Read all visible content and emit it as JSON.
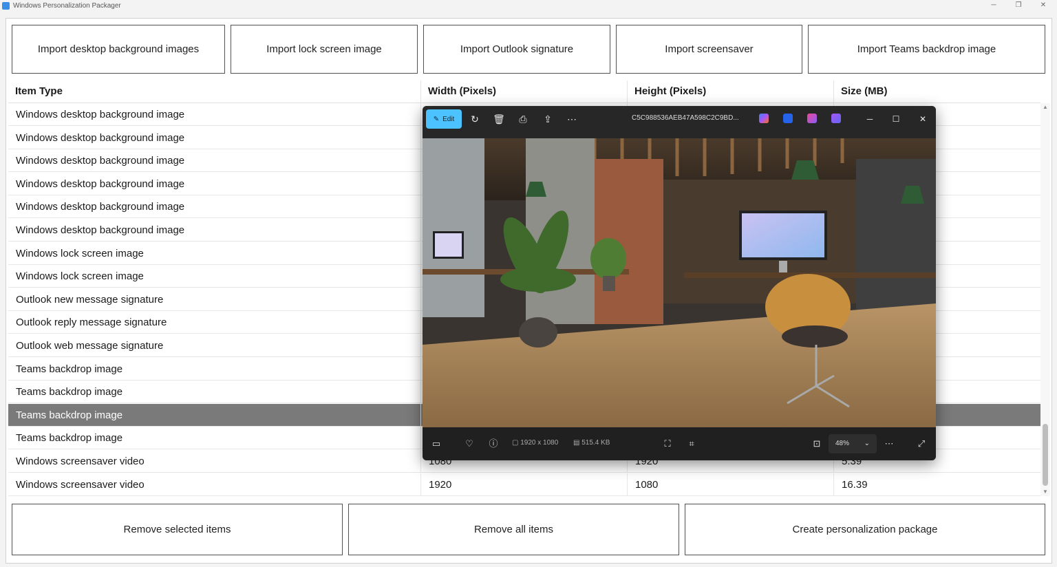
{
  "window": {
    "title": "Windows Personalization Packager",
    "controls": {
      "minimize": "─",
      "restore": "❐",
      "close": "✕"
    }
  },
  "import_buttons": [
    "Import desktop background images",
    "Import lock screen image",
    "Import Outlook signature",
    "Import screensaver",
    "Import Teams backdrop image"
  ],
  "table": {
    "columns": [
      "Item Type",
      "Width (Pixels)",
      "Height (Pixels)",
      "Size (MB)"
    ],
    "rows": [
      [
        "Windows desktop background image",
        "",
        "",
        ""
      ],
      [
        "Windows desktop background image",
        "",
        "",
        ""
      ],
      [
        "Windows desktop background image",
        "",
        "",
        ""
      ],
      [
        "Windows desktop background image",
        "",
        "",
        ""
      ],
      [
        "Windows desktop background image",
        "",
        "",
        ""
      ],
      [
        "Windows desktop background image",
        "",
        "",
        ""
      ],
      [
        "Windows lock screen image",
        "",
        "",
        ""
      ],
      [
        "Windows lock screen image",
        "",
        "",
        ""
      ],
      [
        "Outlook new message signature",
        "",
        "",
        ""
      ],
      [
        "Outlook reply message signature",
        "",
        "",
        ""
      ],
      [
        "Outlook web message signature",
        "",
        "",
        ""
      ],
      [
        "Teams backdrop image",
        "",
        "",
        ""
      ],
      [
        "Teams backdrop image",
        "",
        "",
        ""
      ],
      [
        "Teams backdrop image",
        "",
        "",
        ""
      ],
      [
        "Teams backdrop image",
        "",
        "",
        ""
      ],
      [
        "Windows screensaver video",
        "1080",
        "1920",
        "5.39"
      ],
      [
        "Windows screensaver video",
        "1920",
        "1080",
        "16.39"
      ]
    ],
    "selected_row_index": 13
  },
  "bottom_buttons": [
    "Remove selected items",
    "Remove all items",
    "Create personalization package"
  ],
  "viewer": {
    "edit_label": "Edit",
    "filename": "C5C988536AEB47A598C2C9BD...",
    "toolbar_icons": [
      "rotate-icon",
      "delete-icon",
      "print-icon",
      "share-icon",
      "more-icon"
    ],
    "dimensions": "1920 x 1080",
    "file_size": "515.4 KB",
    "zoom": "48%",
    "colors": {
      "accent": "#4cc2ff",
      "background": "#202020"
    }
  }
}
